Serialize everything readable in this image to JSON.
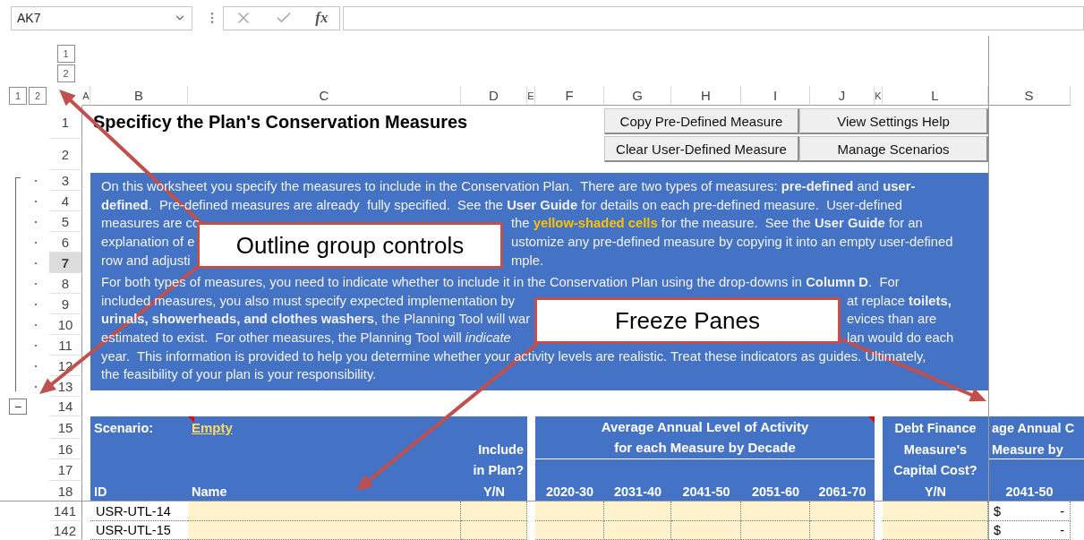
{
  "formula_bar": {
    "name_box": "AK7",
    "insert_function": "fx"
  },
  "outline": {
    "column_levels": [
      "1",
      "2"
    ],
    "row_levels": [
      "1",
      "2"
    ],
    "collapse_button": "−"
  },
  "column_headers": [
    "A",
    "B",
    "C",
    "D",
    "E",
    "F",
    "G",
    "H",
    "I",
    "J",
    "K",
    "L",
    "S"
  ],
  "row_numbers": [
    {
      "label": "1",
      "selected": false
    },
    {
      "label": "2",
      "selected": false
    },
    {
      "label": "3",
      "selected": false
    },
    {
      "label": "4",
      "selected": false
    },
    {
      "label": "5",
      "selected": false
    },
    {
      "label": "6",
      "selected": false
    },
    {
      "label": "7",
      "selected": true
    },
    {
      "label": "8",
      "selected": false
    },
    {
      "label": "9",
      "selected": false
    },
    {
      "label": "10",
      "selected": false
    },
    {
      "label": "11",
      "selected": false
    },
    {
      "label": "12",
      "selected": false
    },
    {
      "label": "13",
      "selected": false
    },
    {
      "label": "14",
      "selected": false
    },
    {
      "label": "15",
      "selected": false
    },
    {
      "label": "16",
      "selected": false
    },
    {
      "label": "17",
      "selected": false
    },
    {
      "label": "18",
      "selected": false
    },
    {
      "label": "141",
      "selected": false
    },
    {
      "label": "142",
      "selected": false
    }
  ],
  "title": "Specificy the Plan's Conservation Measures",
  "buttons": [
    "Copy Pre-Defined Measure",
    "View Settings Help",
    "Clear User-Defined Measure",
    "Manage Scenarios"
  ],
  "instructions": {
    "paragraphs": [
      {
        "lines": [
          {
            "kind": "full",
            "parts": [
              [
                {
                  "kind": "plain",
                  "text": "On this worksheet you specify the measures to include in the Conservation Plan.  There are two types of measures: "
                },
                {
                  "kind": "bold",
                  "text": "pre-defined"
                },
                {
                  "kind": "plain",
                  "text": " and "
                },
                {
                  "kind": "bold",
                  "text": "user-"
                }
              ]
            ]
          },
          {
            "kind": "full",
            "parts": [
              [
                {
                  "kind": "bold",
                  "text": "defined"
                },
                {
                  "kind": "plain",
                  "text": ".  Pre-defined measures are already  fully specified.  See the "
                },
                {
                  "kind": "bold",
                  "text": "User Guide"
                },
                {
                  "kind": "plain",
                  "text": " for details on each pre-defined measure.  User-defined"
                }
              ]
            ]
          },
          {
            "kind": "split-first",
            "parts": [
              [
                {
                  "kind": "plain",
                  "text": "measures are co"
                }
              ],
              [
                {
                  "kind": "plain",
                  "text": "the "
                },
                {
                  "kind": "highlight",
                  "text": "yellow-shaded cells"
                },
                {
                  "kind": "plain",
                  "text": " for the measure.  See the "
                },
                {
                  "kind": "bold",
                  "text": "User Guide"
                },
                {
                  "kind": "plain",
                  "text": " for an"
                }
              ]
            ]
          },
          {
            "kind": "split-first",
            "parts": [
              [
                {
                  "kind": "plain",
                  "text": "explanation of e"
                }
              ],
              [
                {
                  "kind": "plain",
                  "text": "ustomize any pre-defined measure by copying it into an empty user-defined"
                }
              ]
            ]
          },
          {
            "kind": "split-first",
            "parts": [
              [
                {
                  "kind": "plain",
                  "text": "row and adjusti"
                }
              ],
              [
                {
                  "kind": "plain",
                  "text": "mple."
                }
              ]
            ]
          }
        ]
      },
      {
        "lines": [
          {
            "kind": "full",
            "parts": [
              [
                {
                  "kind": "plain",
                  "text": "For both types of measures, you need to indicate whether to include it in the Conservation Plan using the drop-downs in "
                },
                {
                  "kind": "bold",
                  "text": "Column D"
                },
                {
                  "kind": "plain",
                  "text": ".  For"
                }
              ]
            ]
          },
          {
            "kind": "split-second",
            "parts": [
              [
                {
                  "kind": "plain",
                  "text": "included measures, you also must specify expected implementation by"
                }
              ],
              [
                {
                  "kind": "plain",
                  "text": "at replace "
                },
                {
                  "kind": "bold",
                  "text": "toilets,"
                }
              ]
            ]
          },
          {
            "kind": "split-second",
            "parts": [
              [
                {
                  "kind": "bold",
                  "text": "urinals, showerheads, and clothes washers"
                },
                {
                  "kind": "plain",
                  "text": ", the Planning Tool will war"
                }
              ],
              [
                {
                  "kind": "plain",
                  "text": "evices than are"
                }
              ]
            ]
          },
          {
            "kind": "split-second",
            "parts": [
              [
                {
                  "kind": "plain",
                  "text": "estimated to exist.  For other measures, the Planning Tool will "
                },
                {
                  "kind": "italic",
                  "text": "indicate"
                }
              ],
              [
                {
                  "kind": "plain",
                  "text": "lan would do each"
                }
              ]
            ]
          },
          {
            "kind": "full",
            "parts": [
              [
                {
                  "kind": "plain",
                  "text": "year.  This information is provided to help you determine whether your activity levels are realistic. Treat these indicators as guides. Ultimately,"
                }
              ]
            ]
          },
          {
            "kind": "full",
            "parts": [
              [
                {
                  "kind": "plain",
                  "text": "the feasibility of your plan is your responsibility."
                }
              ]
            ]
          }
        ]
      }
    ]
  },
  "table_header": {
    "scenario_label": "Scenario:",
    "scenario_value": "Empty",
    "include": [
      "Include",
      "in Plan?",
      "Y/N"
    ],
    "id": "ID",
    "name": "Name",
    "activity_title": [
      "Average Annual Level of Activity",
      "for each Measure by Decade"
    ],
    "decades": [
      "2020-30",
      "2031-40",
      "2041-50",
      "2051-60",
      "2061-70"
    ],
    "debt": [
      "Debt Finance",
      "Measure's",
      "Capital Cost?",
      "Y/N"
    ],
    "cost_title": [
      "age Annual C",
      "Measure by"
    ],
    "cost_decade": "2041-50"
  },
  "rows": [
    {
      "id": "USR-UTL-14",
      "currency": "$",
      "amount": "-"
    },
    {
      "id": "USR-UTL-15",
      "currency": "$",
      "amount": "-"
    }
  ],
  "callouts": [
    {
      "kind": "outline",
      "label": "Outline group controls"
    },
    {
      "kind": "freeze",
      "label": "Freeze Panes"
    }
  ]
}
